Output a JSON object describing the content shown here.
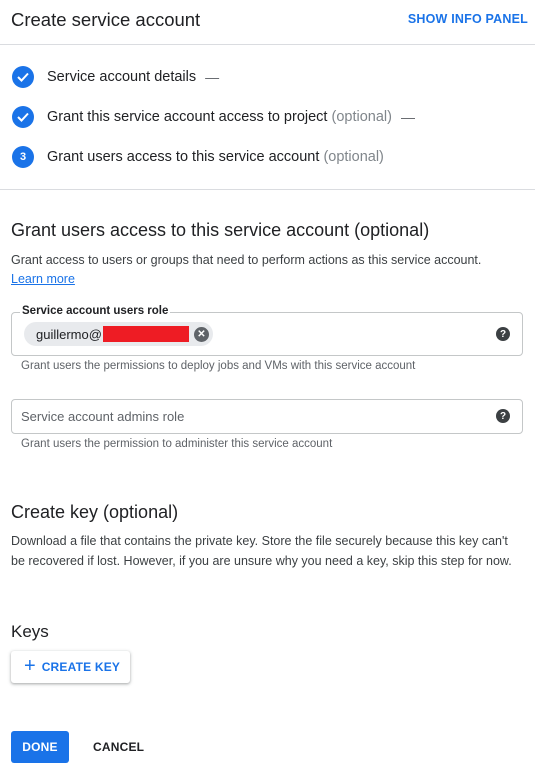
{
  "header": {
    "title": "Create service account",
    "info_panel_button": "SHOW INFO PANEL"
  },
  "steps": [
    {
      "label": "Service account details",
      "optional": "",
      "status": "done",
      "dash": "—"
    },
    {
      "label": "Grant this service account access to project",
      "optional": "(optional)",
      "status": "done",
      "dash": "—"
    },
    {
      "label": "Grant users access to this service account",
      "optional": "(optional)",
      "status": "active",
      "number": "3",
      "dash": ""
    }
  ],
  "grant_section": {
    "title": "Grant users access to this service account (optional)",
    "description": "Grant access to users or groups that need to perform actions as this service account.",
    "learn_more": "Learn more",
    "users_role": {
      "label": "Service account users role",
      "chip_text": "guillermo@",
      "hint": "Grant users the permissions to deploy jobs and VMs with this service account"
    },
    "admins_role": {
      "placeholder": "Service account admins role",
      "hint": "Grant users the permission to administer this service account"
    }
  },
  "key_section": {
    "title": "Create key (optional)",
    "description": "Download a file that contains the private key. Store the file securely because this key can't be recovered if lost. However, if you are unsure why you need a key, skip this step for now.",
    "keys_heading": "Keys",
    "create_key_button": "CREATE KEY"
  },
  "footer": {
    "done_button": "DONE",
    "cancel_button": "CANCEL"
  },
  "colors": {
    "accent": "#1a73e8",
    "redaction": "#ee1c24"
  }
}
